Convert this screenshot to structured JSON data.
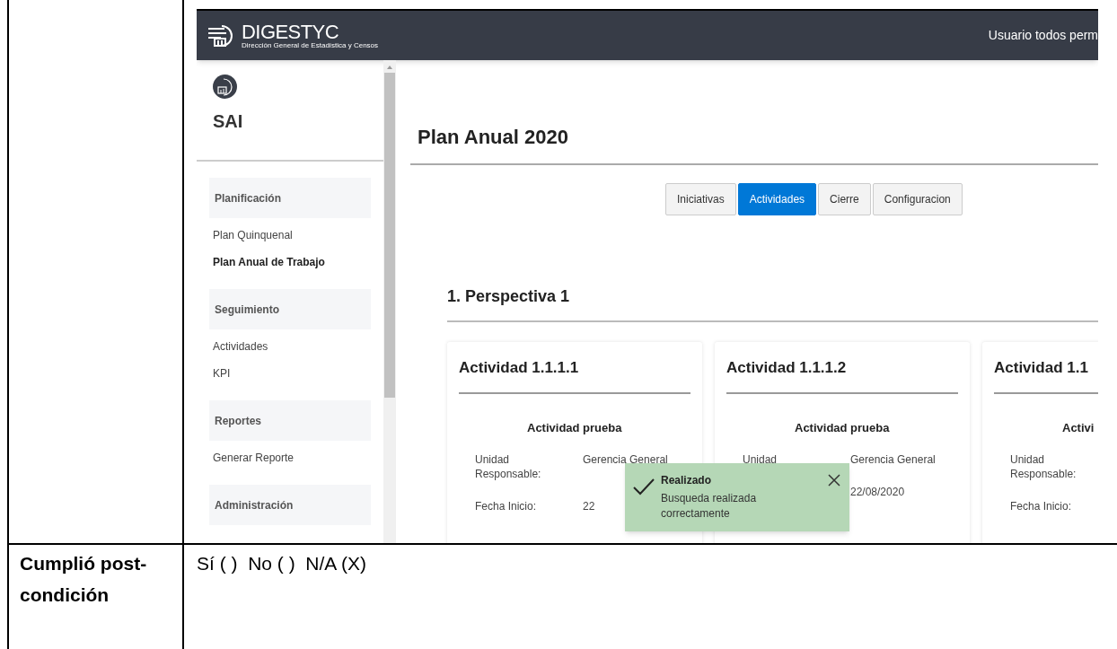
{
  "header": {
    "logo_text": "DIGESTYC",
    "logo_subtitle": "Dirección General de Estadística y Censos",
    "user": "Usuario todos perm"
  },
  "sidebar": {
    "app_name": "SAI",
    "sections": [
      {
        "title": "Planificación",
        "items": [
          {
            "label": "Plan Quinquenal",
            "selected": false
          },
          {
            "label": "Plan Anual de Trabajo",
            "selected": true
          }
        ]
      },
      {
        "title": "Seguimiento",
        "items": [
          {
            "label": "Actividades",
            "selected": false
          },
          {
            "label": "KPI",
            "selected": false
          }
        ]
      },
      {
        "title": "Reportes",
        "items": [
          {
            "label": "Generar Reporte",
            "selected": false
          }
        ]
      },
      {
        "title": "Administración"
      }
    ]
  },
  "page": {
    "title": "Plan Anual 2020",
    "tabs": [
      {
        "label": "Iniciativas",
        "selected": false
      },
      {
        "label": "Actividades",
        "selected": true
      },
      {
        "label": "Cierre",
        "selected": false
      },
      {
        "label": "Configuracion",
        "selected": false
      }
    ],
    "section_title": "1. Perspectiva 1",
    "cards": [
      {
        "title": "Actividad 1.1.1.1",
        "subtitle": "Actividad prueba",
        "fields": [
          {
            "label": "Unidad Responsable:",
            "value": "Gerencia General"
          },
          {
            "label": "Fecha Inicio:",
            "value": "22"
          }
        ]
      },
      {
        "title": "Actividad 1.1.1.2",
        "subtitle": "Actividad prueba",
        "fields": [
          {
            "label": "Unidad",
            "value": "Gerencia General"
          },
          {
            "value": "22/08/2020"
          }
        ]
      },
      {
        "title": "Actividad 1.1",
        "subtitle": "Activi",
        "fields": [
          {
            "label": "Unidad Responsable:"
          },
          {
            "label": "Fecha Inicio:"
          }
        ]
      }
    ]
  },
  "toast": {
    "title": "Realizado",
    "message": "Busqueda realizada correctamente"
  },
  "document": {
    "row_label": "Cumplió post-condición",
    "answer": "Sí ( )  No ( )  N/A (X)"
  }
}
